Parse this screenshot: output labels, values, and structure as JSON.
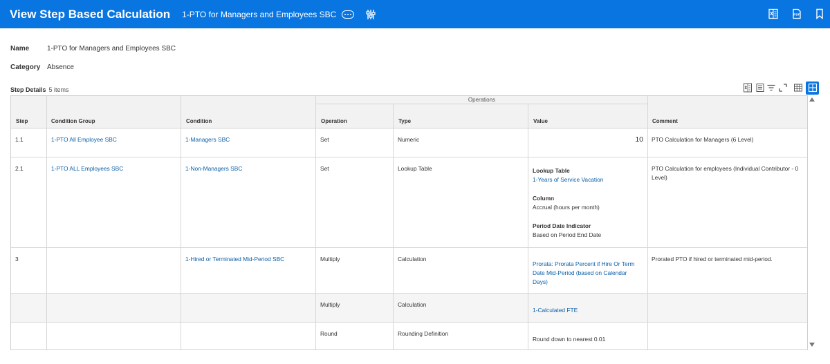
{
  "header": {
    "title": "View Step Based Calculation",
    "subtitle": "1-PTO for Managers and Employees SBC",
    "bg_color": "#0875e1",
    "icons": [
      "related-actions-icon",
      "filter-sliders-icon",
      "excel-export-icon",
      "pdf-icon",
      "bookmark-icon"
    ]
  },
  "fields": {
    "name_label": "Name",
    "name_value": "1-PTO for Managers and Employees SBC",
    "category_label": "Category",
    "category_value": "Absence"
  },
  "grid": {
    "title": "Step Details",
    "count": "5 items",
    "toolbar_icons": [
      "export-excel-icon",
      "columns-icon",
      "filter-icon",
      "fullscreen-icon",
      "table-view-icon",
      "grid-view-icon"
    ],
    "group_header": "Operations",
    "columns": [
      "Step",
      "Condition Group",
      "Condition",
      "Operation",
      "Type",
      "Value",
      "Comment"
    ],
    "rows": [
      {
        "step": "1.1",
        "condition_group": "1-PTO All Employee SBC",
        "condition": "1-Managers SBC",
        "operation": "Set",
        "type": "Numeric",
        "value_number": "10",
        "comment": "PTO Calculation for Managers (6 Level)"
      },
      {
        "step": "2.1",
        "condition_group": "1-PTO ALL Employees SBC",
        "condition": "1-Non-Managers SBC",
        "operation": "Set",
        "type": "Lookup Table",
        "value_lookup_label": "Lookup Table",
        "value_lookup_link": "1-Years of Service Vacation",
        "value_column_label": "Column",
        "value_column_value": "Accrual (hours per month)",
        "value_period_label": "Period Date Indicator",
        "value_period_value": "Based on Period End Date",
        "comment": "PTO Calculation for employees (Individual Contributor - 0 Level)"
      },
      {
        "step": "3",
        "condition_group": "",
        "condition": "1-Hired or Terminated Mid-Period SBC",
        "operation": "Multiply",
        "type": "Calculation",
        "value_link": "Prorata: Prorata Percent if Hire Or Term Date Mid-Period (based on Calendar Days)",
        "comment": "Prorated PTO if hired or terminated mid-period."
      },
      {
        "step": "",
        "condition_group": "",
        "condition": "",
        "operation": "Multiply",
        "type": "Calculation",
        "value_link": "1-Calculated FTE",
        "comment": ""
      },
      {
        "step": "",
        "condition_group": "",
        "condition": "",
        "operation": "Round",
        "type": "Rounding Definition",
        "value_text": "Round down to nearest 0.01",
        "comment": ""
      }
    ]
  }
}
